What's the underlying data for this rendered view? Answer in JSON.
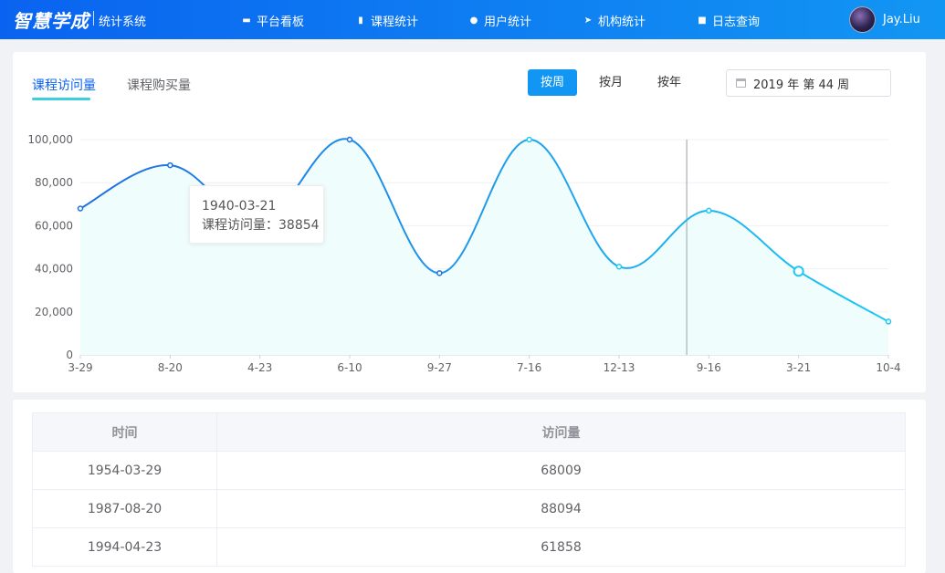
{
  "header": {
    "logo": "智慧学成",
    "subtitle": "统计系统",
    "nav": [
      {
        "label": "平台看板",
        "icon": "monitor-icon"
      },
      {
        "label": "课程统计",
        "icon": "bar-chart-icon"
      },
      {
        "label": "用户统计",
        "icon": "user-icon"
      },
      {
        "label": "机构统计",
        "icon": "send-icon"
      },
      {
        "label": "日志查询",
        "icon": "clipboard-icon"
      }
    ],
    "user": "Jay.Liu"
  },
  "tabs": [
    "课程访问量",
    "课程购买量"
  ],
  "active_tab": 0,
  "period_buttons": [
    "按周",
    "按月",
    "按年"
  ],
  "active_period": 0,
  "date_picker_value": "2019 年 第 44 周",
  "colors": {
    "primary": "#1296f3",
    "line_start": "#1f6fe0",
    "line_end": "#1ec8f5",
    "area": "#f0fdfd",
    "tab_underline": "#3bcfe0"
  },
  "chart_data": {
    "type": "area",
    "categories": [
      "3-29",
      "8-20",
      "4-23",
      "6-10",
      "9-27",
      "7-16",
      "12-13",
      "9-16",
      "3-21",
      "10-4"
    ],
    "series": [
      {
        "values": [
          68009,
          88094,
          61858,
          100000,
          38000,
          100000,
          41000,
          67000,
          38854,
          15500
        ]
      }
    ],
    "ylim": [
      0,
      100000
    ],
    "yticks": [
      "0",
      "20,000",
      "40,000",
      "60,000",
      "80,000",
      "100,000"
    ],
    "grid": true,
    "highlight_index": 8,
    "marker_index": 7
  },
  "tooltip": {
    "date": "1940-03-21",
    "text": "课程访问量：38854"
  },
  "table": {
    "headers": [
      "时间",
      "访问量"
    ],
    "rows": [
      [
        "1954-03-29",
        "68009"
      ],
      [
        "1987-08-20",
        "88094"
      ],
      [
        "1994-04-23",
        "61858"
      ]
    ]
  }
}
